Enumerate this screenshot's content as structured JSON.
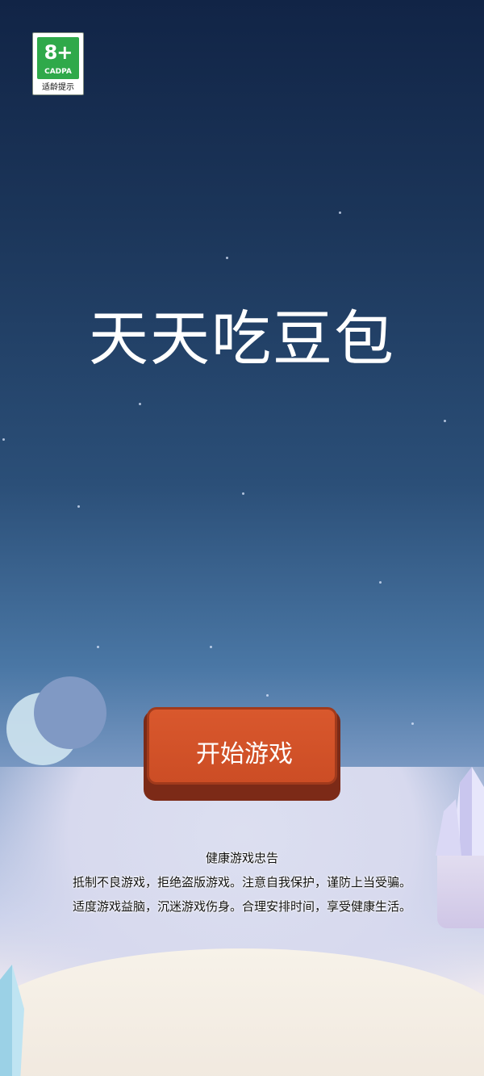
{
  "age_badge": {
    "rating": "8+",
    "org": "CADPA",
    "tip": "适龄提示"
  },
  "title": "天天吃豆包",
  "start_button": {
    "label": "开始游戏"
  },
  "health_notice": {
    "heading": "健康游戏忠告",
    "line1": "抵制不良游戏，拒绝盗版游戏。注意自我保护，谨防上当受骗。",
    "line2": "适度游戏益脑，沉迷游戏伤身。合理安排时间，享受健康生活。"
  },
  "colors": {
    "button": "#cc4d25",
    "badge_green": "#2fa94a",
    "sky_top": "#112446"
  }
}
